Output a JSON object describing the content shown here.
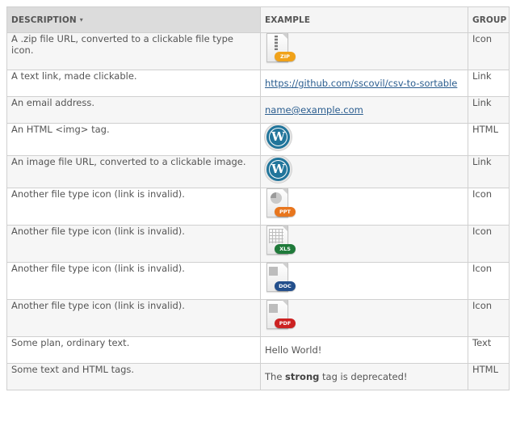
{
  "table": {
    "headers": {
      "description": "DESCRIPTION",
      "sort_indicator": "▾",
      "example": "EXAMPLE",
      "group": "GROUP"
    },
    "rows": [
      {
        "description": "A .zip file URL, converted to a clickable file type icon.",
        "example_type": "file-icon",
        "icon_label": "ZIP",
        "icon_color": "#f0a21a",
        "icon_name": "zip-file-icon",
        "group": "Icon"
      },
      {
        "description": "A text link, made clickable.",
        "example_type": "link",
        "example_text": "https://github.com/sscovil/csv-to-sortable",
        "group": "Link"
      },
      {
        "description": "An email address.",
        "example_type": "link",
        "example_text": "name@example.com",
        "group": "Link"
      },
      {
        "description": "An HTML <img> tag.",
        "example_type": "image",
        "icon_name": "wordpress-logo-icon",
        "logo_glyph": "W",
        "group": "HTML"
      },
      {
        "description": "An image file URL, converted to a clickable image.",
        "example_type": "image",
        "icon_name": "wordpress-logo-icon",
        "logo_glyph": "W",
        "group": "Link"
      },
      {
        "description": "Another file type icon (link is invalid).",
        "example_type": "file-icon",
        "icon_label": "PPT",
        "icon_color": "#e8761e",
        "icon_name": "ppt-file-icon",
        "group": "Icon"
      },
      {
        "description": "Another file type icon (link is invalid).",
        "example_type": "file-icon",
        "icon_label": "XLS",
        "icon_color": "#1f7a3a",
        "icon_name": "xls-file-icon",
        "group": "Icon"
      },
      {
        "description": "Another file type icon (link is invalid).",
        "example_type": "file-icon",
        "icon_label": "DOC",
        "icon_color": "#234f8c",
        "icon_name": "doc-file-icon",
        "group": "Icon"
      },
      {
        "description": "Another file type icon (link is invalid).",
        "example_type": "file-icon",
        "icon_label": "PDF",
        "icon_color": "#cc2222",
        "icon_name": "pdf-file-icon",
        "group": "Icon"
      },
      {
        "description": "Some plan, ordinary text.",
        "example_type": "text",
        "example_text": "Hello World!",
        "group": "Text"
      },
      {
        "description": "Some text and HTML tags.",
        "example_type": "rich",
        "example_pre": "The ",
        "example_strong": "strong",
        "example_post": " tag is deprecated!",
        "group": "HTML"
      }
    ]
  },
  "colors": {
    "header_sorted_bg": "#dcdcdc",
    "header_bg": "#f5f5f5",
    "row_stripe": "#f6f6f6",
    "link": "#2a5d8f",
    "border": "#d0d0d0"
  }
}
